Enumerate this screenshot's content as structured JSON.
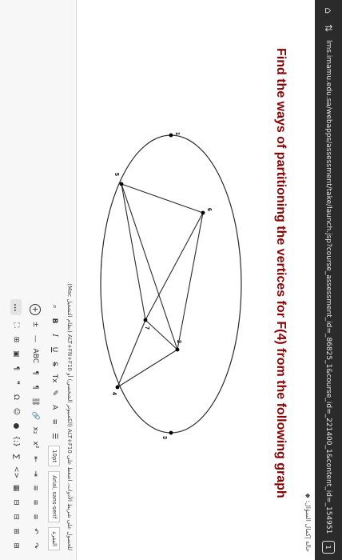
{
  "browser": {
    "tab_count": "1",
    "url": "lms.imamu.edu.sa/webapps/assessment/take/launch.jsp?course_assessment_id=_86825_1&course_id=_221400_1&content_id=_1549515_1&step=null"
  },
  "breadcrumb": "حالة إكمال السؤال: ◆",
  "question": "Find the ways of partitioning the vertices for F(4) from the following graph",
  "graph": {
    "nodes": [
      {
        "label": "1"
      },
      {
        "label": "2"
      },
      {
        "label": "3"
      },
      {
        "label": "4"
      },
      {
        "label": "5"
      },
      {
        "label": "6"
      },
      {
        "label": "7"
      }
    ]
  },
  "editor": {
    "hint": "للحصول على شريط الأدوات، اضغط على ALT+F10 (الكمبيوتر الشخصي) أو ALT+FN+F10 (نظام التشغيل Mac).",
    "paragraph_select": "الفقرة",
    "font_select": "Arial, sans-serif",
    "size_select": "10pt",
    "row1": {
      "bold": "B",
      "italic": "I",
      "underline": "U",
      "strike": "S",
      "font_color": "A",
      "highlight": "✎",
      "clear": "Tx"
    },
    "row2": {
      "superscript": "x²",
      "subscript": "x₂",
      "link": "🔗",
      "unlink": "⛓",
      "rtl": "¶",
      "ltr": "¶",
      "spell": "ABC",
      "hr": "—",
      "table": "±"
    },
    "row3": {
      "code": "<>",
      "special": "Ω",
      "emoji": "☺",
      "media": "●",
      "image": "▣",
      "embed": "⊞",
      "html": "{;}",
      "sigma": "∑",
      "more": "..."
    }
  },
  "colors": {
    "question": "#8b0000",
    "graph_line": "#2a2a2a",
    "node_fill": "#000000"
  }
}
